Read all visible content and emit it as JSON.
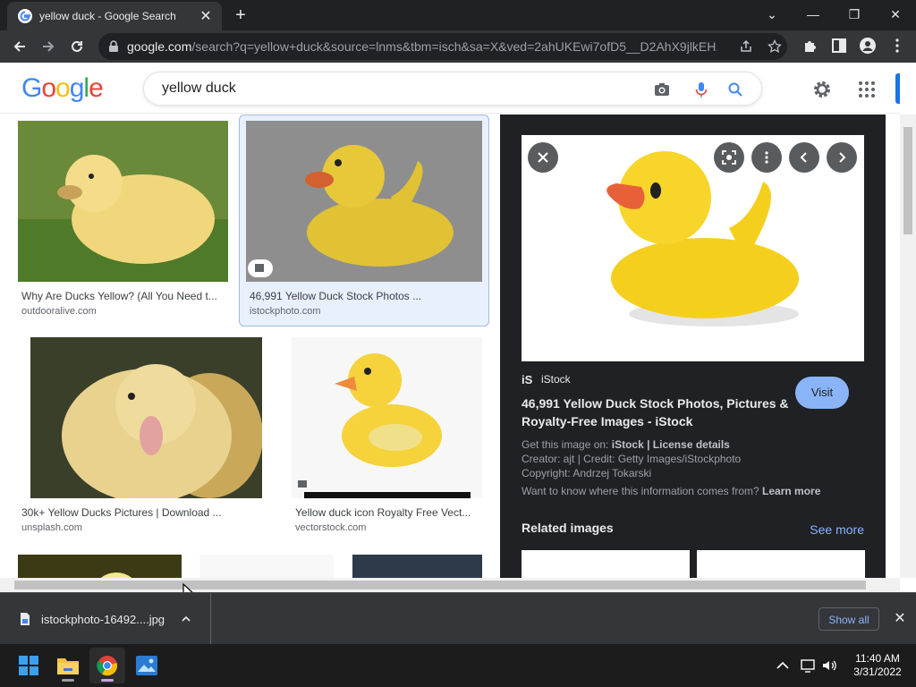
{
  "browser": {
    "tab_title": "yellow duck - Google Search",
    "url_host": "google.com",
    "url_path": "/search?q=yellow+duck&source=lnms&tbm=isch&sa=X&ved=2ahUKEwi7ofD5__D2AhX9jlkEH..."
  },
  "search": {
    "query": "yellow duck"
  },
  "results": [
    {
      "title": "Why Are Ducks Yellow? (All You Need t...",
      "source": "outdooralive.com"
    },
    {
      "title": "46,991 Yellow Duck Stock Photos ...",
      "source": "istockphoto.com"
    },
    {
      "title": "30k+ Yellow Ducks Pictures | Download ...",
      "source": "unsplash.com"
    },
    {
      "title": "Yellow duck icon Royalty Free Vect...",
      "source": "vectorstock.com"
    }
  ],
  "preview": {
    "source_name": "iStock",
    "title": "46,991 Yellow Duck Stock Photos, Pictures & Royalty-Free Images - iStock",
    "visit_label": "Visit",
    "get_image_label": "Get this image on:",
    "get_image_source": "iStock",
    "license_label": "License details",
    "creator_line": "Creator: ajt | Credit: Getty Images/iStockphoto",
    "copyright_line": "Copyright: Andrzej Tokarski",
    "info_question": "Want to know where this information comes from?",
    "learn_more": "Learn more",
    "related_title": "Related images",
    "see_more": "See more"
  },
  "download_bar": {
    "file_name": "istockphoto-16492....jpg",
    "show_all": "Show all"
  },
  "taskbar": {
    "time": "11:40 AM",
    "date": "3/31/2022"
  },
  "colors": {
    "google_blue": "#4285f4",
    "google_red": "#ea4335",
    "google_yellow": "#fbbc05",
    "google_green": "#34a853",
    "link_blue": "#8ab4f8"
  }
}
